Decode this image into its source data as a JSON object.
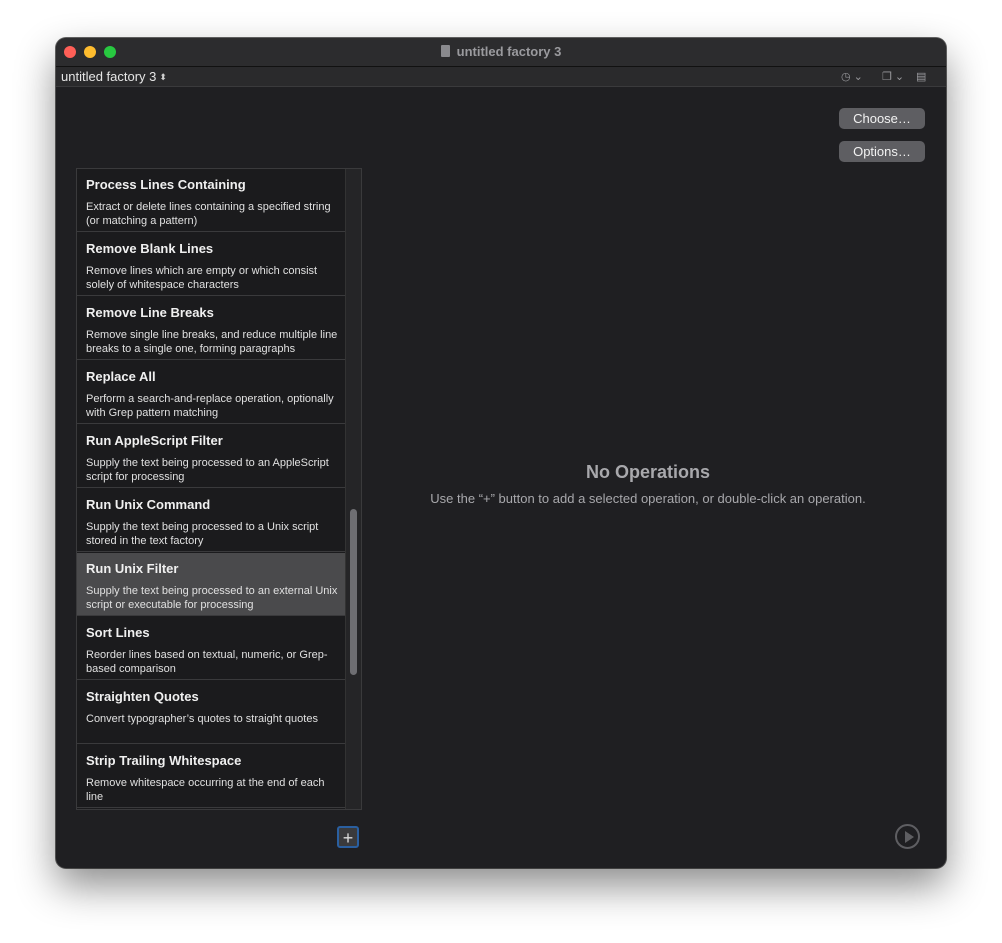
{
  "window": {
    "title": "untitled factory 3"
  },
  "pathbar": {
    "document_name": "untitled factory 3",
    "history_icon": "clock-icon",
    "view_icon": "stack-icon",
    "page_icon": "page-icon"
  },
  "buttons": {
    "choose_label": "Choose…",
    "options_label": "Options…"
  },
  "operations": [
    {
      "title": "Process Lines Containing",
      "desc": "Extract or delete lines containing a specified string (or matching a pattern)"
    },
    {
      "title": "Remove Blank Lines",
      "desc": "Remove lines which are empty or which consist solely of whitespace characters"
    },
    {
      "title": "Remove Line Breaks",
      "desc": "Remove single line breaks, and reduce multiple line breaks to a single one, forming paragraphs"
    },
    {
      "title": "Replace All",
      "desc": "Perform a search-and-replace operation, optionally with Grep pattern matching"
    },
    {
      "title": "Run AppleScript Filter",
      "desc": "Supply the text being processed to an AppleScript script for processing"
    },
    {
      "title": "Run Unix Command",
      "desc": "Supply the text being processed to a Unix script stored in the text factory"
    },
    {
      "title": "Run Unix Filter",
      "desc": "Supply the text being processed to an external Unix script or executable for processing"
    },
    {
      "title": "Sort Lines",
      "desc": "Reorder lines based on textual, numeric, or Grep-based comparison"
    },
    {
      "title": "Straighten Quotes",
      "desc": "Convert typographer’s quotes to straight quotes"
    },
    {
      "title": "Strip Trailing Whitespace",
      "desc": "Remove whitespace occurring at the end of each line"
    }
  ],
  "selected_operation": "Run Unix Filter",
  "empty_state": {
    "title": "No Operations",
    "subtitle": "Use the “+” button to add a selected operation, or double-click an operation."
  },
  "add_button": {
    "label": "+"
  },
  "colors": {
    "accent": "#2a5fa0",
    "window_bg": "#1f1f22",
    "selected_row": "#4a4a4c"
  }
}
